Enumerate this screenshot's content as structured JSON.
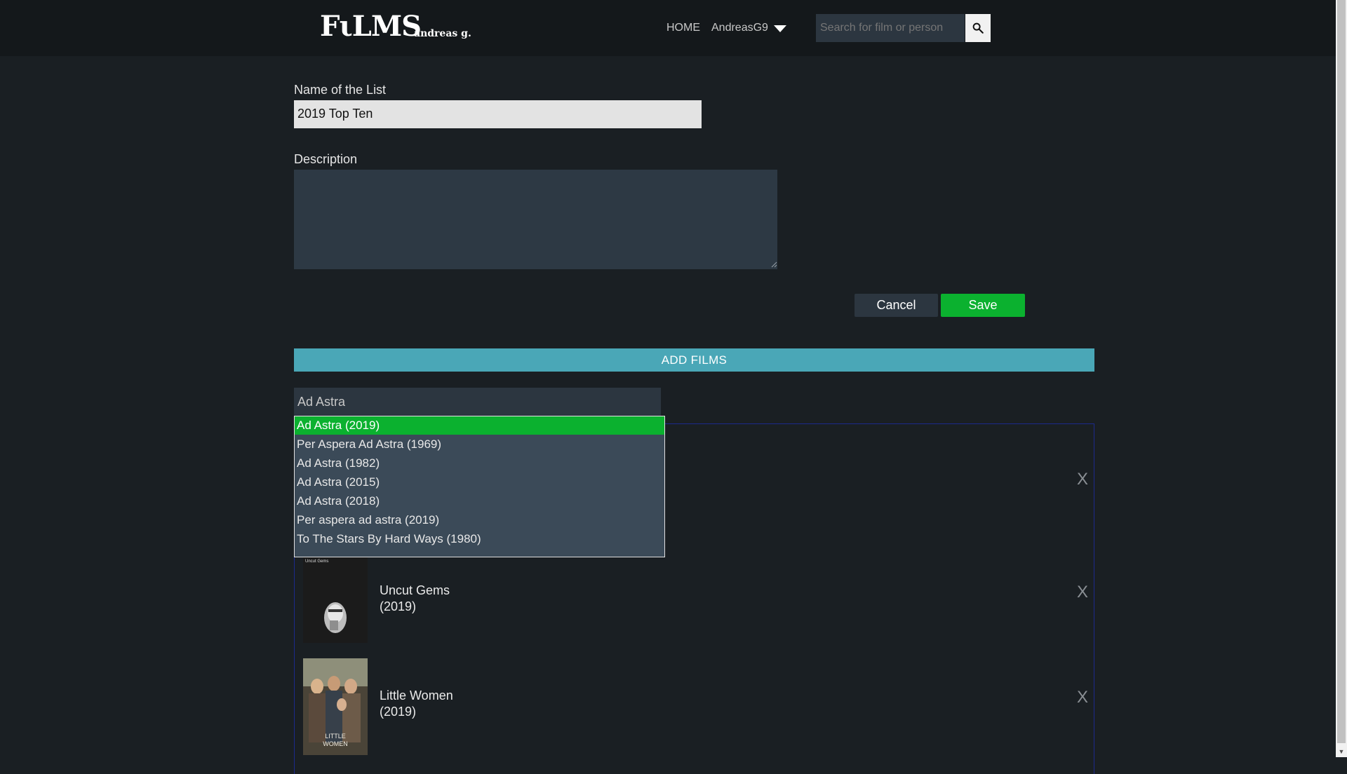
{
  "header": {
    "logo": "FιLMS",
    "logo_sub": "andreas g.",
    "nav_home": "HOME",
    "nav_user": "AndreasG9",
    "search_placeholder": "Search for film or person"
  },
  "form": {
    "name_label": "Name of the List",
    "name_value": "2019 Top Ten",
    "description_label": "Description",
    "description_value": "",
    "cancel_label": "Cancel",
    "save_label": "Save"
  },
  "add_films": {
    "bar_label": "ADD FILMS",
    "search_value": "Ad Astra",
    "suggestions": [
      "Ad Astra (2019)",
      "Per Aspera Ad Astra (1969)",
      "Ad Astra (1982)",
      "Ad Astra (2015)",
      "Ad Astra (2018)",
      "Per aspera ad astra (2019)",
      "To The Stars By Hard Ways (1980)"
    ],
    "selected_index": 0
  },
  "films": [
    {
      "title": "",
      "year": "",
      "remove": "X"
    },
    {
      "title": "Uncut Gems",
      "year": "(2019)",
      "poster_text": "Uncut Gems",
      "remove": "X"
    },
    {
      "title": "Little Women",
      "year": "(2019)",
      "poster_text": "LITTLE WOMEN",
      "remove": "X"
    }
  ],
  "colors": {
    "accent_save": "#0bb12f",
    "add_films_bar": "#4aa7b7",
    "background": "#1a1f23",
    "header_bg": "#14181b"
  }
}
